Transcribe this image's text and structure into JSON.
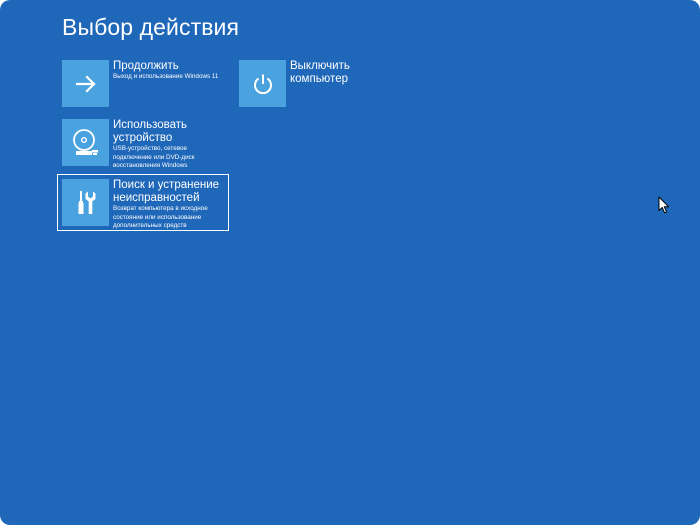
{
  "screen": {
    "title": "Выбор действия",
    "background": "#1f67b9",
    "tile_accent": "#4aa3df"
  },
  "options": [
    {
      "id": "continue",
      "title_lines": [
        "Продолжить"
      ],
      "desc_lines": [
        "Выход и использование Windows 11"
      ],
      "icon": "arrow-right-icon",
      "selected": false
    },
    {
      "id": "shutdown",
      "title_lines": [
        "Выключить",
        "компьютер"
      ],
      "desc_lines": [],
      "icon": "power-icon",
      "selected": false
    },
    {
      "id": "use-device",
      "title_lines": [
        "Использовать",
        "устройство"
      ],
      "desc_lines": [
        "USB-устройство, сетевое",
        "подключение или DVD-диск",
        "восстановления Windows"
      ],
      "icon": "disc-drive-icon",
      "selected": false
    },
    {
      "id": "troubleshoot",
      "title_lines": [
        "Поиск и устранение",
        "неисправностей"
      ],
      "desc_lines": [
        "Возврат компьютера в исходное",
        "состояние или использование",
        "дополнительных средств"
      ],
      "icon": "tools-icon",
      "selected": true
    }
  ],
  "pointer": {
    "icon": "mouse-pointer-icon"
  }
}
